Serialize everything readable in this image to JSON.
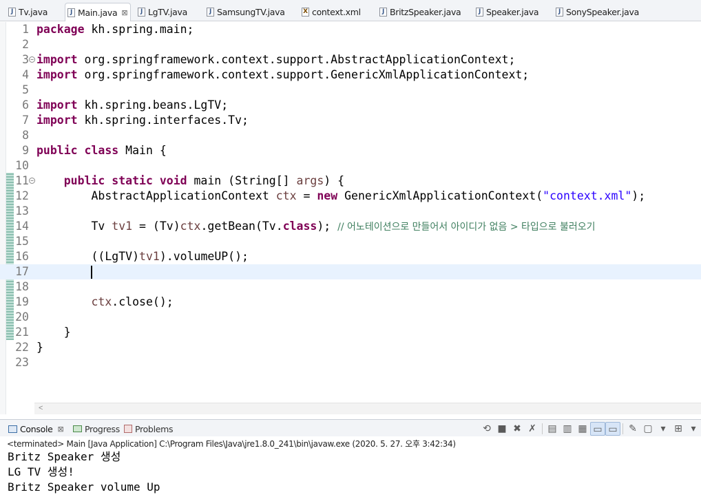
{
  "editor_tabs": [
    {
      "label": "Tv.java",
      "icon": "java-file-icon"
    },
    {
      "label": "Main.java",
      "icon": "java-file-icon",
      "active": true
    },
    {
      "label": "LgTV.java",
      "icon": "java-file-icon"
    },
    {
      "label": "SamsungTV.java",
      "icon": "java-file-icon"
    },
    {
      "label": "context.xml",
      "icon": "xml-file-icon"
    },
    {
      "label": "BritzSpeaker.java",
      "icon": "java-file-icon"
    },
    {
      "label": "Speaker.java",
      "icon": "java-file-icon"
    },
    {
      "label": "SonySpeaker.java",
      "icon": "java-file-icon"
    }
  ],
  "close_glyph": "⊠",
  "code": {
    "line_numbers": [
      "1",
      "2",
      "3",
      "4",
      "5",
      "6",
      "7",
      "8",
      "9",
      "10",
      "11",
      "12",
      "13",
      "14",
      "15",
      "16",
      "17",
      "18",
      "19",
      "20",
      "21",
      "22",
      "23"
    ],
    "l1": {
      "kw": "package",
      "rest": " kh.spring.main;"
    },
    "l3": {
      "kw": "import",
      "rest": " org.springframework.context.support.AbstractApplicationContext;"
    },
    "l4": {
      "kw": "import",
      "rest": " org.springframework.context.support.GenericXmlApplicationContext;"
    },
    "l6": {
      "kw": "import",
      "rest": " kh.spring.beans.LgTV;"
    },
    "l7": {
      "kw": "import",
      "rest": " kh.spring.interfaces.Tv;"
    },
    "l9": {
      "kw": "public class",
      "rest": " Main {"
    },
    "l11": {
      "indent": "    ",
      "kw": "public static void",
      "rest1": " main (String[] ",
      "var": "args",
      "rest2": ") {"
    },
    "l12": {
      "indent": "        ",
      "t1": "AbstractApplicationContext ",
      "var": "ctx",
      "t2": " = ",
      "kw": "new",
      "t3": " GenericXmlApplicationContext(",
      "str": "\"context.xml\"",
      "t4": ");"
    },
    "l14": {
      "indent": "        ",
      "t1": "Tv ",
      "var": "tv1",
      "t2": " = (Tv)",
      "var2": "ctx",
      "t3": ".getBean(Tv.",
      "kw": "class",
      "t4": "); ",
      "comment": "// 어노테이션으로 만들어서 아이디가 없음 > 타입으로 불러오기"
    },
    "l16": {
      "indent": "        ",
      "t1": "((LgTV)",
      "var": "tv1",
      "t2": ").volumeUP();"
    },
    "l19": {
      "indent": "        ",
      "var": "ctx",
      "t1": ".close();"
    },
    "l21": {
      "indent": "    ",
      "t1": "}"
    },
    "l22": {
      "t1": "}"
    }
  },
  "console": {
    "tabs": [
      {
        "label": "Console",
        "icon": "console-icon",
        "active": true
      },
      {
        "label": "Progress",
        "icon": "progress-icon"
      },
      {
        "label": "Problems",
        "icon": "problems-icon"
      }
    ],
    "toolbar": [
      "pin-icon",
      "terminate-icon",
      "remove-launch-icon",
      "remove-all-icon",
      "clear-console-icon",
      "scroll-lock-icon",
      "word-wrap-icon",
      "show-stdout-icon",
      "show-stderr-icon",
      "pin-console-icon",
      "display-console-icon",
      "open-console-icon"
    ],
    "terminated_line": "<terminated> Main [Java Application] C:\\Program Files\\Java\\jre1.8.0_241\\bin\\javaw.exe (2020. 5. 27. 오후 3:42:34)",
    "output": [
      "Britz Speaker 생성",
      "LG TV 생성!",
      "Britz Speaker volume Up"
    ]
  }
}
